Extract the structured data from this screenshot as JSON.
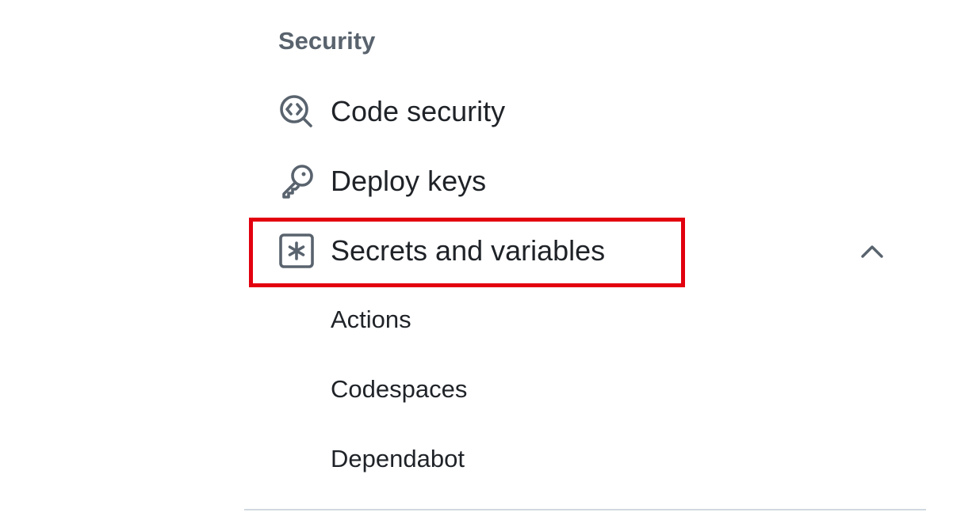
{
  "sidebar": {
    "section_heading": "Security",
    "items": [
      {
        "label": "Code security",
        "icon": "codescan-icon"
      },
      {
        "label": "Deploy keys",
        "icon": "key-icon"
      },
      {
        "label": "Secrets and variables",
        "icon": "key-asterisk-icon",
        "expanded": true,
        "highlighted": true
      }
    ],
    "sub_items": [
      {
        "label": "Actions"
      },
      {
        "label": "Codespaces"
      },
      {
        "label": "Dependabot"
      }
    ]
  },
  "colors": {
    "highlight": "#e3000f",
    "text": "#1f2328",
    "muted": "#59636e",
    "divider": "#d1d9e0"
  }
}
